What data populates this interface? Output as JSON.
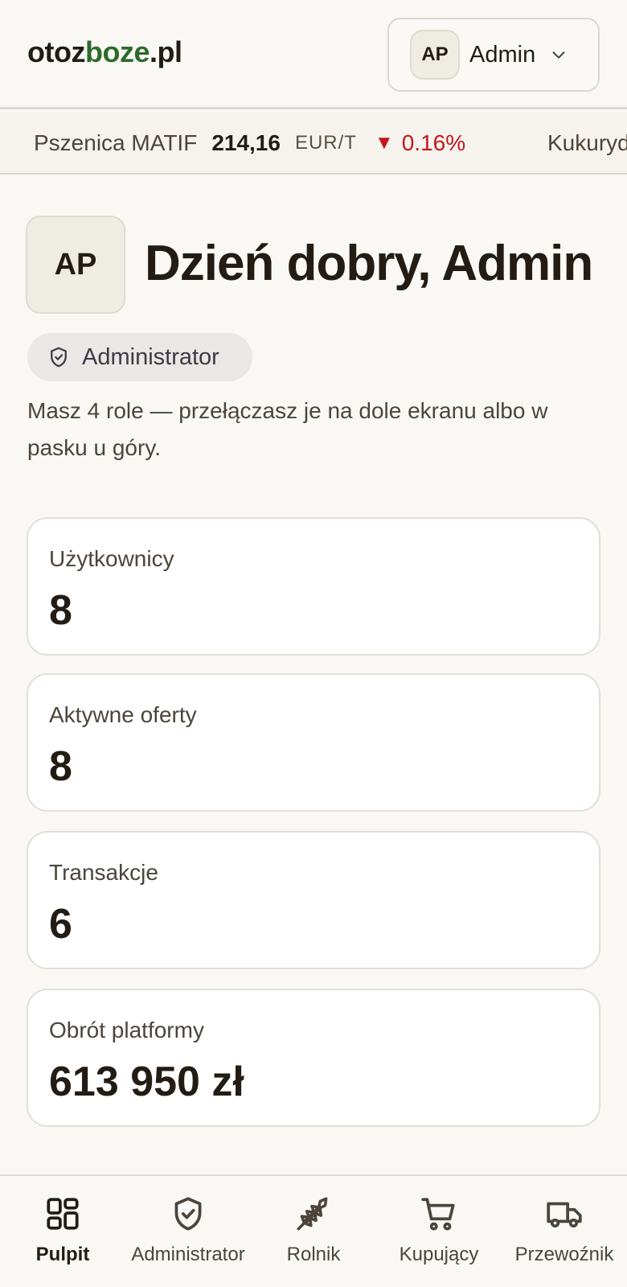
{
  "header": {
    "logo_part1": "otoz",
    "logo_part2": "boze",
    "logo_part3": ".pl",
    "user_initials": "AP",
    "user_name": "Admin"
  },
  "ticker": [
    {
      "name": "Pszenica MATIF",
      "price": "214,16",
      "unit": "EUR/T",
      "arrow": "▼",
      "change": "0.16%",
      "direction": "down"
    },
    {
      "name": "Kukurydza",
      "price": "",
      "unit": "",
      "arrow": "",
      "change": "",
      "direction": ""
    }
  ],
  "greeting": {
    "initials": "AP",
    "title": "Dzień dobry, Admin",
    "role_badge": "Administrator",
    "description": "Masz 4 role — przełączasz je na dole ekranu albo w pasku u góry."
  },
  "stats": [
    {
      "label": "Użytkownicy",
      "value": "8"
    },
    {
      "label": "Aktywne oferty",
      "value": "8"
    },
    {
      "label": "Transakcje",
      "value": "6"
    },
    {
      "label": "Obrót platformy",
      "value": "613 950 zł"
    }
  ],
  "bottom_nav": [
    {
      "label": "Pulpit",
      "icon": "dashboard-icon",
      "active": true
    },
    {
      "label": "Administrator",
      "icon": "shield-icon",
      "active": false
    },
    {
      "label": "Rolnik",
      "icon": "wheat-icon",
      "active": false
    },
    {
      "label": "Kupujący",
      "icon": "cart-icon",
      "active": false
    },
    {
      "label": "Przewoźnik",
      "icon": "truck-icon",
      "active": false
    }
  ],
  "colors": {
    "background": "#faf8f4",
    "brand_green": "#2d6b2a",
    "text_dark": "#231c15",
    "down_red": "#c4161c"
  }
}
